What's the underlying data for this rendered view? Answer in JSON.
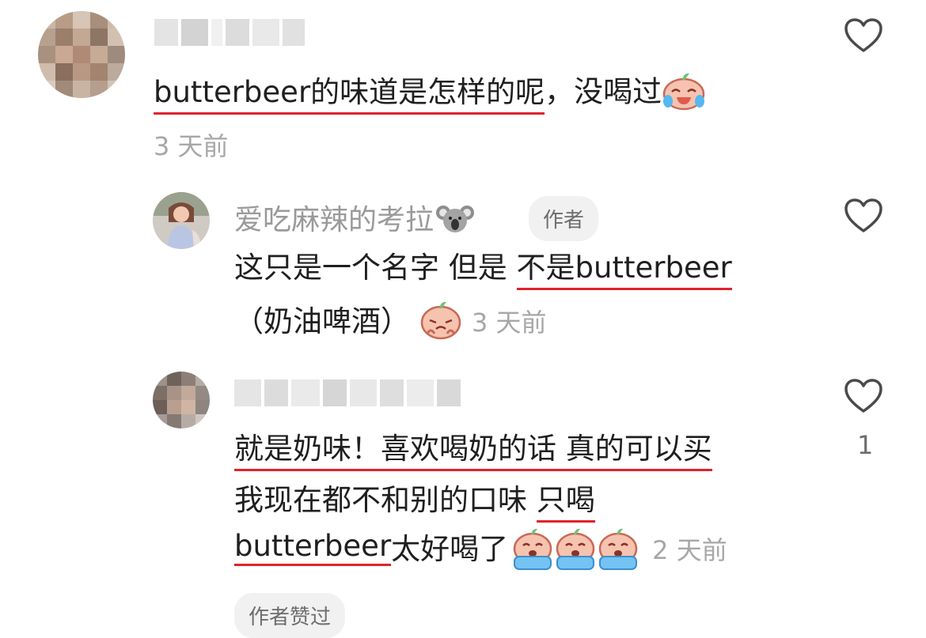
{
  "comments": [
    {
      "username": "",
      "text_underlined": "butterbeer的味道是怎样的呢",
      "text_rest": "，没喝过",
      "emoji": "crying-laugh-emoji",
      "time": "3 天前"
    },
    {
      "username": "爱吃麻辣的考拉",
      "username_emoji": "koala-emoji",
      "badge": "作者",
      "line1_plain": "这只是一个名字 但是 ",
      "line1_underlined": "不是butterbeer",
      "line2_text": "（奶油啤酒）",
      "emoji": "pleading-emoji",
      "time": "3 天前"
    },
    {
      "username": "",
      "line1_underlined": "就是奶味！喜欢喝奶的话 真的可以买",
      "line2_plain": "我现在都不和别的口味 ",
      "line2_underlined": "只喝",
      "line3_underlined": "butterbeer",
      "line3_plain": " 太好喝了",
      "emoji": "crying-emoji",
      "time": "2 天前",
      "likes": "1",
      "author_liked": "作者赞过"
    }
  ],
  "colors": {
    "underline": "#e0222e",
    "muted": "#9a9a9a",
    "badge_bg": "#f1f1f1"
  }
}
